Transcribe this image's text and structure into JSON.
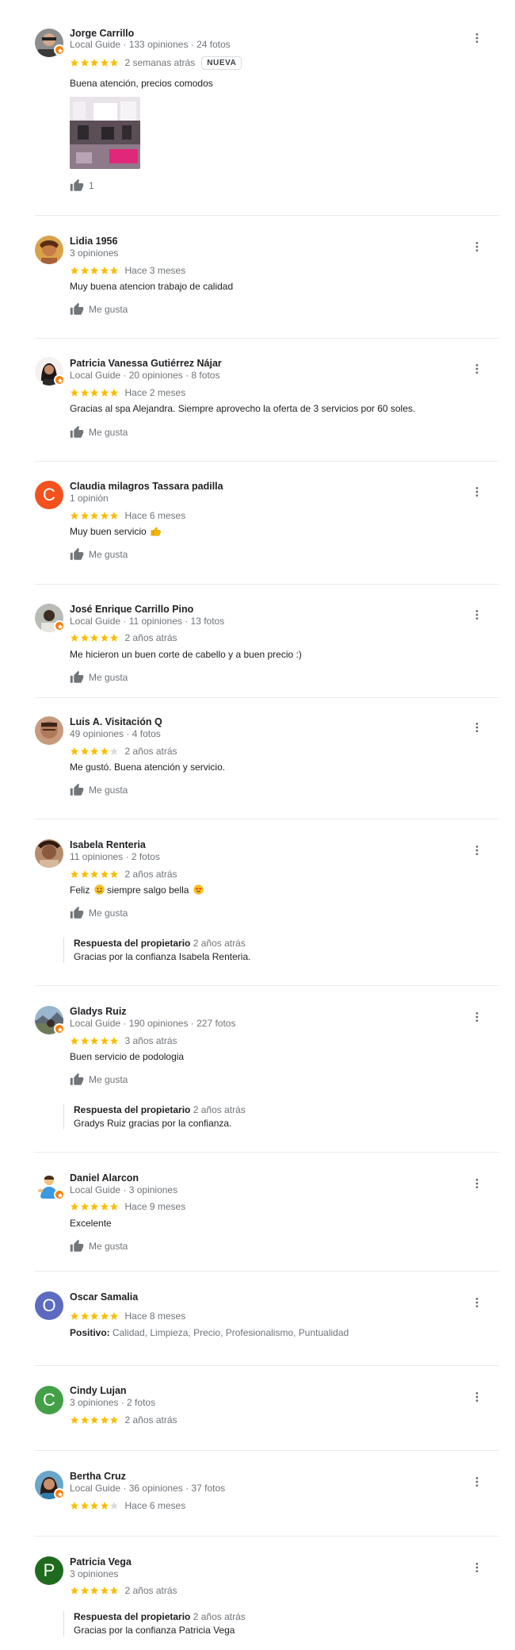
{
  "colors": {
    "star": "#fbbc04",
    "star_empty": "#dadce0",
    "local_guide_badge": "#f57c00",
    "avatar_C": "#f4511e",
    "avatar_O": "#5c6bc0",
    "avatar_C2": "#43a047",
    "avatar_P": "#1e6b1e"
  },
  "reviews": [
    {
      "name": "Jorge Carrillo",
      "meta": "Local Guide · 133 opiniones · 24 fotos",
      "stars": 5,
      "when": "2 semanas atrás",
      "badge": "NUEVA",
      "text": "Buena atención, precios comodos",
      "like_label": "1",
      "avatar": "photo-man-sunglasses",
      "photo": "salon-interior-photo"
    },
    {
      "name": "Lidia 1956",
      "meta": "3 opiniones",
      "stars": 5,
      "when": "Hace 3 meses",
      "text": "Muy buena atencion trabajo de calidad",
      "like_label": "Me gusta",
      "avatar": "photo-woman"
    },
    {
      "name": "Patricia Vanessa Gutiérrez Nájar",
      "meta": "Local Guide · 20 opiniones · 8 fotos",
      "stars": 5,
      "when": "Hace 2 meses",
      "text": "Gracias al spa Alejandra. Siempre aprovecho la oferta de 3 servicios por 60 soles.",
      "like_label": "Me gusta",
      "avatar": "photo-woman-dark-hair"
    },
    {
      "name": "Claudia milagros Tassara padilla",
      "meta": "1 opinión",
      "stars": 5,
      "when": "Hace 6 meses",
      "text": "Muy buen servicio",
      "text_emoji": "thumbs-up-emoji",
      "like_label": "Me gusta",
      "avatar_letter": "C"
    },
    {
      "name": "José Enrique Carrillo Pino",
      "meta": "Local Guide · 11 opiniones · 13 fotos",
      "stars": 5,
      "when": "2 años atrás",
      "text": "Me hicieron un buen corte de cabello y a buen precio :)",
      "like_label": "Me gusta",
      "avatar": "photo-man-outdoor"
    },
    {
      "name": "Luis A. Visitación Q",
      "meta": "49 opiniones · 4 fotos",
      "stars": 4,
      "when": "2 años atrás",
      "text": "Me gustó. Buena atención y servicio.",
      "like_label": "Me gusta",
      "avatar": "photo-man-face"
    },
    {
      "name": "Isabela Renteria",
      "meta": "11 opiniones · 2 fotos",
      "stars": 5,
      "when": "2 años atrás",
      "text_pre": "Feliz",
      "text_post": "siempre salgo bella",
      "like_label": "Me gusta",
      "avatar": "photo-woman-pattern",
      "owner_label": "Respuesta del propietario",
      "owner_when": "2 años atrás",
      "owner_text": "Gracias por la confianza Isabela Renteria."
    },
    {
      "name": "Gladys Ruiz",
      "meta": "Local Guide · 190 opiniones · 227 fotos",
      "stars": 5,
      "when": "3 años atrás",
      "text": "Buen servicio de podologia",
      "like_label": "Me gusta",
      "avatar": "photo-landscape",
      "owner_label": "Respuesta del propietario",
      "owner_when": "2 años atrás",
      "owner_text": "Gradys Ruiz gracias por la confianza."
    },
    {
      "name": "Daniel Alarcon",
      "meta": "Local Guide · 3 opiniones",
      "stars": 5,
      "when": "Hace 9 meses",
      "text": "Excelente",
      "like_label": "Me gusta",
      "avatar": "photo-cartoon-man"
    },
    {
      "name": "Oscar Samalia",
      "stars": 5,
      "when": "Hace 8 meses",
      "positive_label": "Positivo:",
      "positive_text": "Calidad, Limpieza, Precio, Profesionalismo, Puntualidad",
      "avatar_letter": "O"
    },
    {
      "name": "Cindy Lujan",
      "meta": "3 opiniones · 2 fotos",
      "stars": 5,
      "when": "2 años atrás",
      "avatar_letter": "C"
    },
    {
      "name": "Bertha Cruz",
      "meta": "Local Guide · 36 opiniones · 37 fotos",
      "stars": 4,
      "when": "Hace 6 meses",
      "avatar": "photo-woman-smiling"
    },
    {
      "name": "Patricia Vega",
      "meta": "3 opiniones",
      "stars": 5,
      "when": "2 años atrás",
      "avatar_letter": "P",
      "owner_label": "Respuesta del propietario",
      "owner_when": "2 años atrás",
      "owner_text": "Gracias por la confianza Patricia Vega"
    }
  ]
}
